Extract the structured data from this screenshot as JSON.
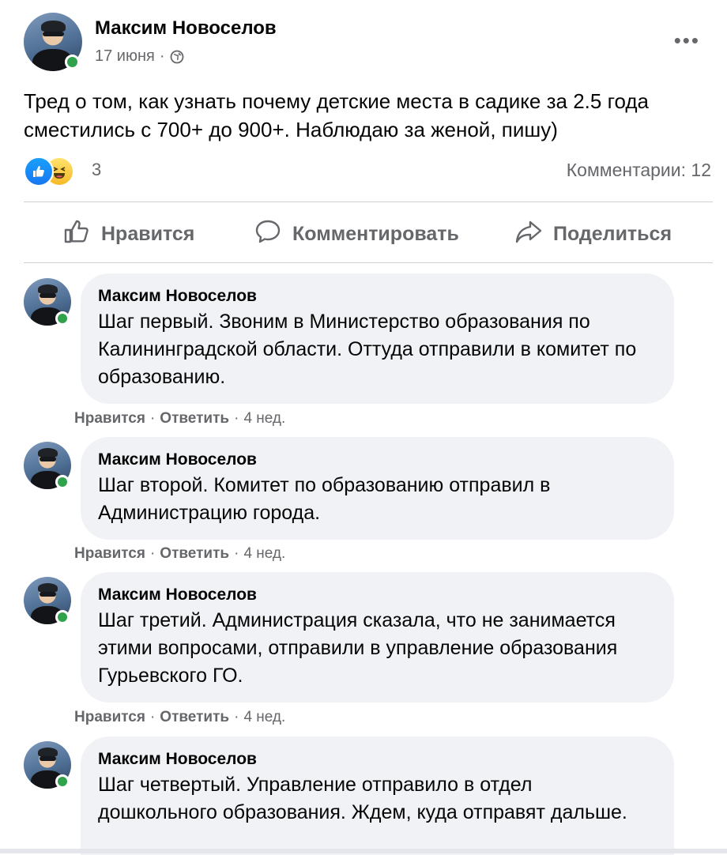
{
  "post": {
    "author": "Максим Новоселов",
    "date": "17 июня",
    "separator": "·",
    "text": "Тред о том, как узнать почему детские места в садике за 2.5 года сместились с 700+ до 900+. Наблюдаю за женой, пишу)",
    "reaction_count": "3",
    "comments_label": "Комментарии: 12"
  },
  "actions": {
    "like": "Нравится",
    "comment": "Комментировать",
    "share": "Поделиться"
  },
  "comments": [
    {
      "author": "Максим Новоселов",
      "text": "Шаг первый. Звоним в Министерство образования по Калининградской области. Оттуда отправили в комитет по образованию.",
      "like": "Нравится",
      "reply": "Ответить",
      "time": "4 нед.",
      "sep": "·"
    },
    {
      "author": "Максим Новоселов",
      "text": "Шаг второй. Комитет по образованию отправил в Администрацию города.",
      "like": "Нравится",
      "reply": "Ответить",
      "time": "4 нед.",
      "sep": "·"
    },
    {
      "author": "Максим Новоселов",
      "text": "Шаг третий. Администрация сказала, что не занимается этими вопросами, отправили в управление образования Гурьевского ГО.",
      "like": "Нравится",
      "reply": "Ответить",
      "time": "4 нед.",
      "sep": "·"
    },
    {
      "author": "Максим Новоселов",
      "text": "Шаг четвертый. Управление отправило в отдел дошкольного образования. Ждем, куда отправят дальше."
    }
  ],
  "colors": {
    "accent": "#1877f2",
    "online": "#31a24c",
    "secondary_text": "#65676b",
    "bubble": "#f0f2f5"
  },
  "icons": [
    "globe-icon",
    "more-icon",
    "like-reaction-icon",
    "haha-reaction-icon",
    "thumbs-up-icon",
    "comment-bubble-icon",
    "share-arrow-icon"
  ]
}
